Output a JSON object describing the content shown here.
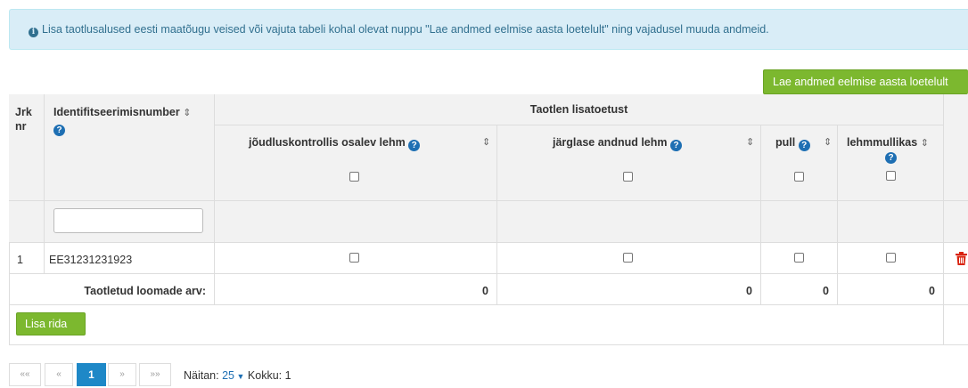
{
  "alert": {
    "text": "Lisa taotlusalused eesti maatõugu veised või vajuta tabeli kohal olevat nuppu \"Lae andmed eelmise aasta loetelult\" ning vajadusel muuda andmeid."
  },
  "load_button": "Lae andmed eelmise aasta loetelult",
  "table": {
    "col_jrk": "Jrk nr",
    "col_id": "Identifitseerimisnumber",
    "group_header": "Taotlen lisatoetust",
    "col_milk": "jõudluskontrollis osalev lehm",
    "col_offspring": "järglase andnud lehm",
    "col_bull": "pull",
    "col_heifer": "lehmmullikas",
    "filter_value": "",
    "rows": [
      {
        "nr": "1",
        "id": "EE31231231923",
        "milk": false,
        "offspring": false,
        "bull": false,
        "heifer": false
      }
    ],
    "totals_label": "Taotletud loomade arv:",
    "totals": {
      "milk": "0",
      "offspring": "0",
      "bull": "0",
      "heifer": "0"
    }
  },
  "add_row_button": "Lisa rida",
  "pagination": {
    "first": "««",
    "prev": "«",
    "current": "1",
    "next": "»",
    "last": "»»",
    "showing_label": "Näitan:",
    "page_size": "25",
    "total_label": "Kokku:",
    "total": "1"
  },
  "icons": {
    "info": "info-circle-icon",
    "help": "question-circle-icon",
    "sort": "sort-icon",
    "delete": "trash-icon"
  },
  "colors": {
    "alert_bg": "#d9edf7",
    "button_green": "#7cb82f",
    "pager_active": "#1e88c7",
    "delete_red": "#d9230f"
  }
}
